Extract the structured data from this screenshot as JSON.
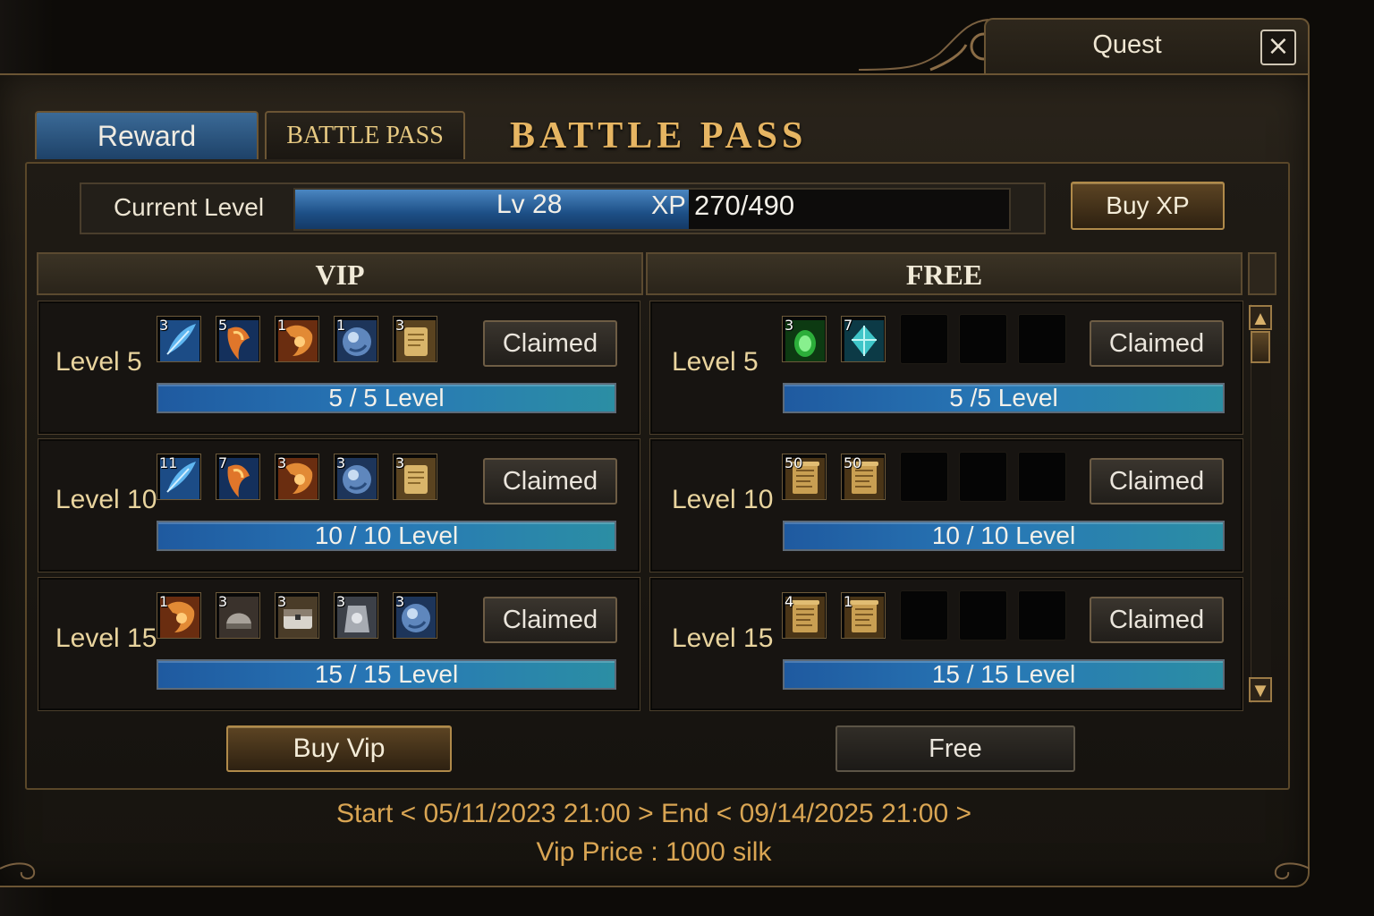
{
  "window": {
    "title": "Quest",
    "close_icon": "×"
  },
  "tabs": [
    {
      "label": "Reward"
    },
    {
      "label": "BATTLE PASS"
    }
  ],
  "header": {
    "title": "BATTLE PASS"
  },
  "level": {
    "label": "Current Level",
    "level_text": "Lv 28",
    "xp_label": "XP",
    "xp_text": "270/490",
    "xp_current": 270,
    "xp_max": 490,
    "buy_xp_label": "Buy XP"
  },
  "columns": {
    "vip": "VIP",
    "free": "FREE"
  },
  "vip_rows": [
    {
      "level": "Level 5",
      "button": "Claimed",
      "progress": "5 / 5 Level",
      "progress_fraction": 1.0,
      "items": [
        {
          "count": "3",
          "icon": "blue-feather-icon"
        },
        {
          "count": "5",
          "icon": "fire-crystal-icon"
        },
        {
          "count": "1",
          "icon": "orange-scroll-icon"
        },
        {
          "count": "1",
          "icon": "blue-orb-icon"
        },
        {
          "count": "3",
          "icon": "gold-tablet-icon"
        }
      ]
    },
    {
      "level": "Level 10",
      "button": "Claimed",
      "progress": "10 / 10 Level",
      "progress_fraction": 1.0,
      "items": [
        {
          "count": "11",
          "icon": "blue-feather-icon"
        },
        {
          "count": "7",
          "icon": "fire-crystal-icon"
        },
        {
          "count": "3",
          "icon": "orange-scroll-icon"
        },
        {
          "count": "3",
          "icon": "blue-orb-icon"
        },
        {
          "count": "3",
          "icon": "gold-tablet-icon"
        }
      ]
    },
    {
      "level": "Level 15",
      "button": "Claimed",
      "progress": "15 / 15 Level",
      "progress_fraction": 1.0,
      "items": [
        {
          "count": "1",
          "icon": "orange-scroll-icon"
        },
        {
          "count": "3",
          "icon": "silver-helmet-icon"
        },
        {
          "count": "3",
          "icon": "silver-chest-icon"
        },
        {
          "count": "3",
          "icon": "silver-orb-icon"
        },
        {
          "count": "3",
          "icon": "blue-orb-icon"
        }
      ]
    }
  ],
  "free_rows": [
    {
      "level": "Level 5",
      "button": "Claimed",
      "progress": "5 /5 Level",
      "progress_fraction": 1.0,
      "items": [
        {
          "count": "3",
          "icon": "green-gem-icon"
        },
        {
          "count": "7",
          "icon": "teal-crystal-icon"
        }
      ]
    },
    {
      "level": "Level 10",
      "button": "Claimed",
      "progress": "10 / 10 Level",
      "progress_fraction": 1.0,
      "items": [
        {
          "count": "50",
          "icon": "gold-scroll-icon"
        },
        {
          "count": "50",
          "icon": "gold-scroll-icon"
        }
      ]
    },
    {
      "level": "Level 15",
      "button": "Claimed",
      "progress": "15 / 15 Level",
      "progress_fraction": 1.0,
      "items": [
        {
          "count": "4",
          "icon": "gold-scroll-icon"
        },
        {
          "count": "1",
          "icon": "gold-scroll-icon"
        }
      ]
    }
  ],
  "buttons": {
    "buy_vip": "Buy Vip",
    "free": "Free"
  },
  "footer": {
    "schedule": "Start < 05/11/2023 21:00 > End < 09/14/2025 21:00 >",
    "vip_price": "Vip Price : 1000 silk"
  },
  "colors": {
    "accent_gold": "#e6b562",
    "progress_blue": "#2878b6",
    "tab_active": "#2f5a85"
  }
}
